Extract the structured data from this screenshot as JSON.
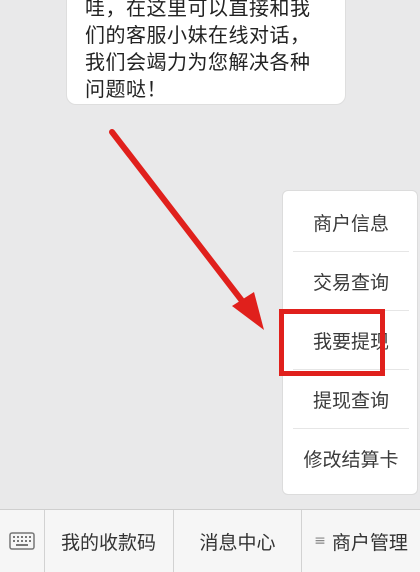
{
  "chat": {
    "bubble_lines": [
      "哇，在这里可以直接和我",
      "们的客服小妹在线对话，",
      "我们会竭力为您解决各种",
      "问题哒！"
    ]
  },
  "popup_menu": {
    "items": [
      {
        "label": "商户信息"
      },
      {
        "label": "交易查询"
      },
      {
        "label": "我要提现",
        "highlighted": true
      },
      {
        "label": "提现查询"
      },
      {
        "label": "修改结算卡"
      }
    ]
  },
  "bottom_bar": {
    "keyboard_icon": "keyboard-icon",
    "tabs": [
      {
        "label": "我的收款码"
      },
      {
        "label": "消息中心"
      },
      {
        "label": "商户管理",
        "icon": "menu-lines-icon"
      }
    ]
  },
  "colors": {
    "annotation_red": "#e0201c",
    "background": "#e9e9ea"
  }
}
